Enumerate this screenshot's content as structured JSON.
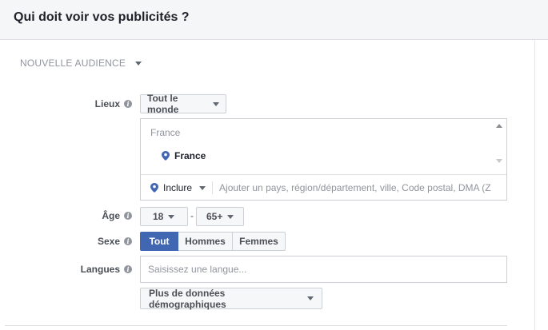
{
  "header": {
    "title": "Qui doit voir vos publicités ?"
  },
  "audience": {
    "header_label": "NOUVELLE AUDIENCE"
  },
  "locations": {
    "label": "Lieux",
    "scope_button": "Tout le monde",
    "group_name": "France",
    "items": [
      {
        "name": "France"
      }
    ],
    "include_button": "Inclure",
    "input_placeholder": "Ajouter un pays, région/département, ville, Code postal, DMA (Z"
  },
  "age": {
    "label": "Âge",
    "min": "18",
    "separator": "-",
    "max": "65+"
  },
  "gender": {
    "label": "Sexe",
    "options": [
      "Tout",
      "Hommes",
      "Femmes"
    ],
    "selected": "Tout"
  },
  "languages": {
    "label": "Langues",
    "input_placeholder": "Saisissez une langue..."
  },
  "demographics": {
    "button_label": "Plus de données démographiques"
  },
  "icons": {
    "info": "info-icon",
    "pin": "location-pin-icon",
    "caret": "chevron-down-icon"
  },
  "colors": {
    "accent": "#4267b2",
    "pin": "#4267b2",
    "header_bg": "#f5f6f7",
    "muted_text": "#90949c"
  }
}
